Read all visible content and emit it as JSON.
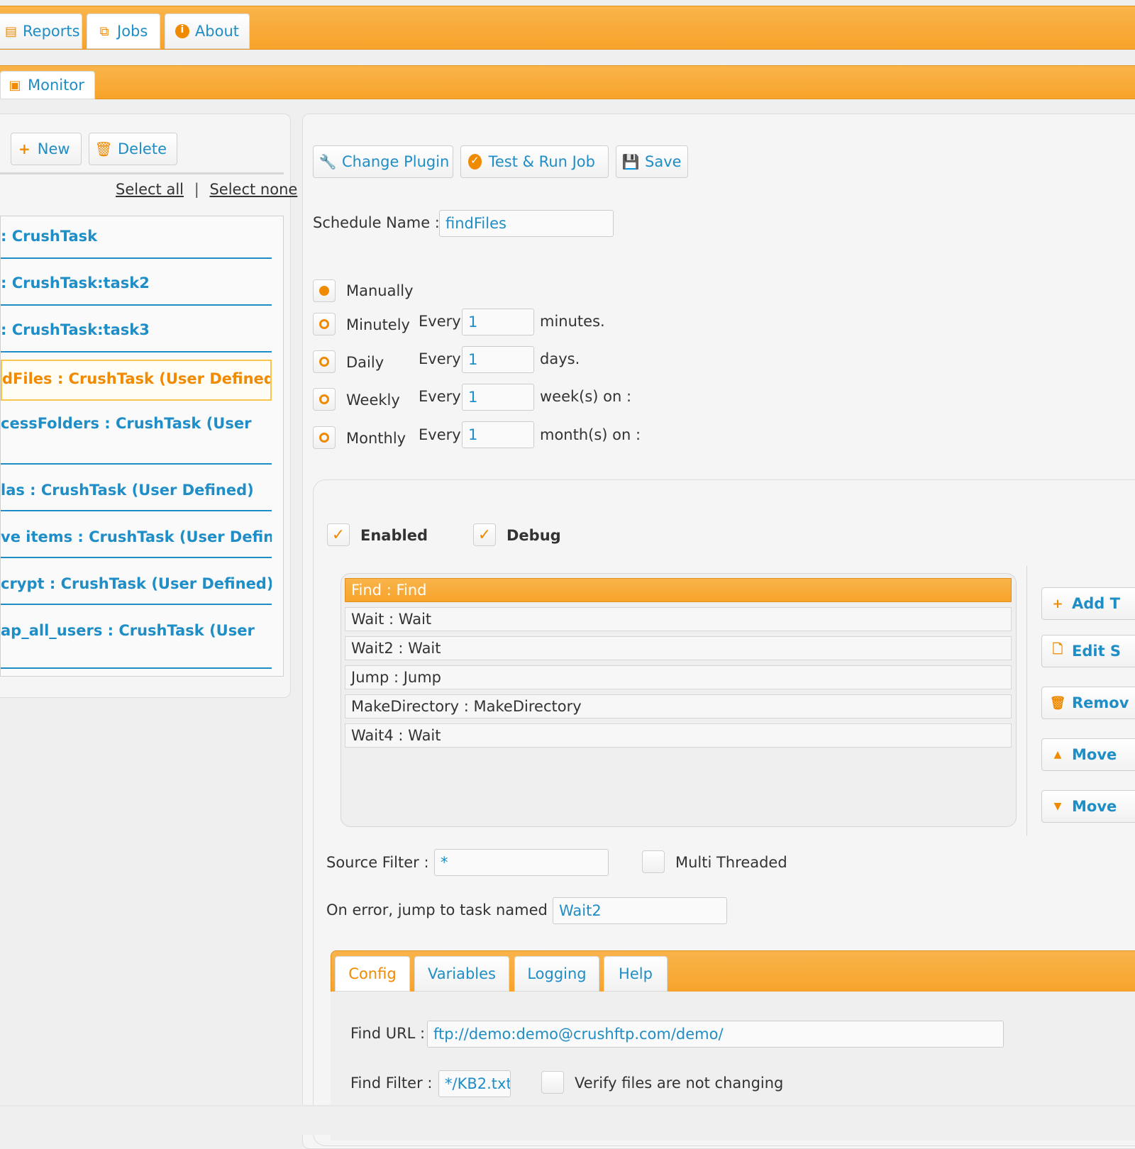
{
  "top_tabs": [
    {
      "label": "Reports",
      "icon": "reports-icon"
    },
    {
      "label": "Jobs",
      "icon": "jobs-icon"
    },
    {
      "label": "About",
      "icon": "info-icon"
    }
  ],
  "second_tab": {
    "label": "Monitor",
    "icon": "monitor-icon"
  },
  "left_panel": {
    "new_label": "New",
    "delete_label": "Delete",
    "select_all": "Select all",
    "separator": "|",
    "select_none": "Select none",
    "jobs": [
      ": CrushTask",
      ": CrushTask:task2",
      ": CrushTask:task3",
      "dFiles : CrushTask (User Defined)",
      "cessFolders : CrushTask (User",
      "las : CrushTask (User Defined)",
      "ve items : CrushTask (User Defined)",
      "crypt : CrushTask (User Defined)",
      "ap_all_users : CrushTask (User"
    ]
  },
  "toolbar": {
    "change_plugin": "Change Plugin",
    "test_run": "Test & Run Job",
    "save": "Save"
  },
  "schedule": {
    "name_label": "Schedule Name :",
    "name_value": "findFiles",
    "manually": "Manually",
    "every": "Every",
    "minutely": {
      "label": "Minutely",
      "value": "1",
      "unit": "minutes."
    },
    "daily": {
      "label": "Daily",
      "value": "1",
      "unit": "days."
    },
    "weekly": {
      "label": "Weekly",
      "value": "1",
      "unit": "week(s) on :"
    },
    "monthly": {
      "label": "Monthly",
      "value": "1",
      "unit": "month(s) on :"
    }
  },
  "flags": {
    "enabled": "Enabled",
    "debug": "Debug",
    "check": "✓"
  },
  "tasks": [
    "Find : Find",
    "Wait : Wait",
    "Wait2 : Wait",
    "Jump : Jump",
    "MakeDirectory : MakeDirectory",
    "Wait4 : Wait"
  ],
  "side_buttons": [
    "Add T",
    "Edit S",
    "Remov",
    "Move",
    "Move"
  ],
  "source_filter": {
    "label": "Source Filter :",
    "value": "*"
  },
  "multi_threaded": "Multi Threaded",
  "on_error": {
    "label": "On error, jump to task named :",
    "value": "Wait2"
  },
  "sub_tabs": [
    "Config",
    "Variables",
    "Logging",
    "Help"
  ],
  "config": {
    "find_url_label": "Find URL :",
    "find_url_value": "ftp://demo:demo@crushftp.com/demo/",
    "find_filter_label": "Find Filter :",
    "find_filter_value": "*/KB2.txt",
    "verify_label": "Verify files are not changing"
  },
  "colors": {
    "accent": "#f7a32a",
    "link": "#1f8dc6",
    "icon": "#f08a00"
  }
}
